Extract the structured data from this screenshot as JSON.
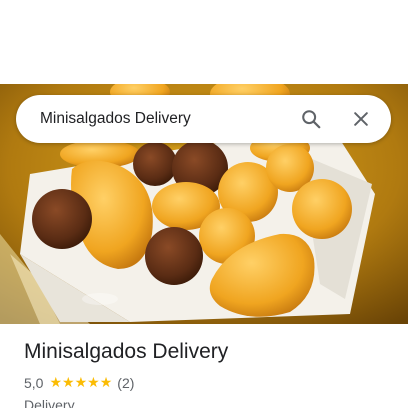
{
  "search": {
    "query": "Minisalgados Delivery"
  },
  "place": {
    "name": "Minisalgados Delivery",
    "rating": "5,0",
    "stars": 5,
    "review_count": "(2)",
    "category": "Delivery"
  },
  "icons": {
    "search": "search-icon",
    "close": "close-icon",
    "star": "star-icon"
  },
  "colors": {
    "star": "#fbbc04",
    "title_text": "#202124",
    "secondary_text": "#5f6368"
  }
}
